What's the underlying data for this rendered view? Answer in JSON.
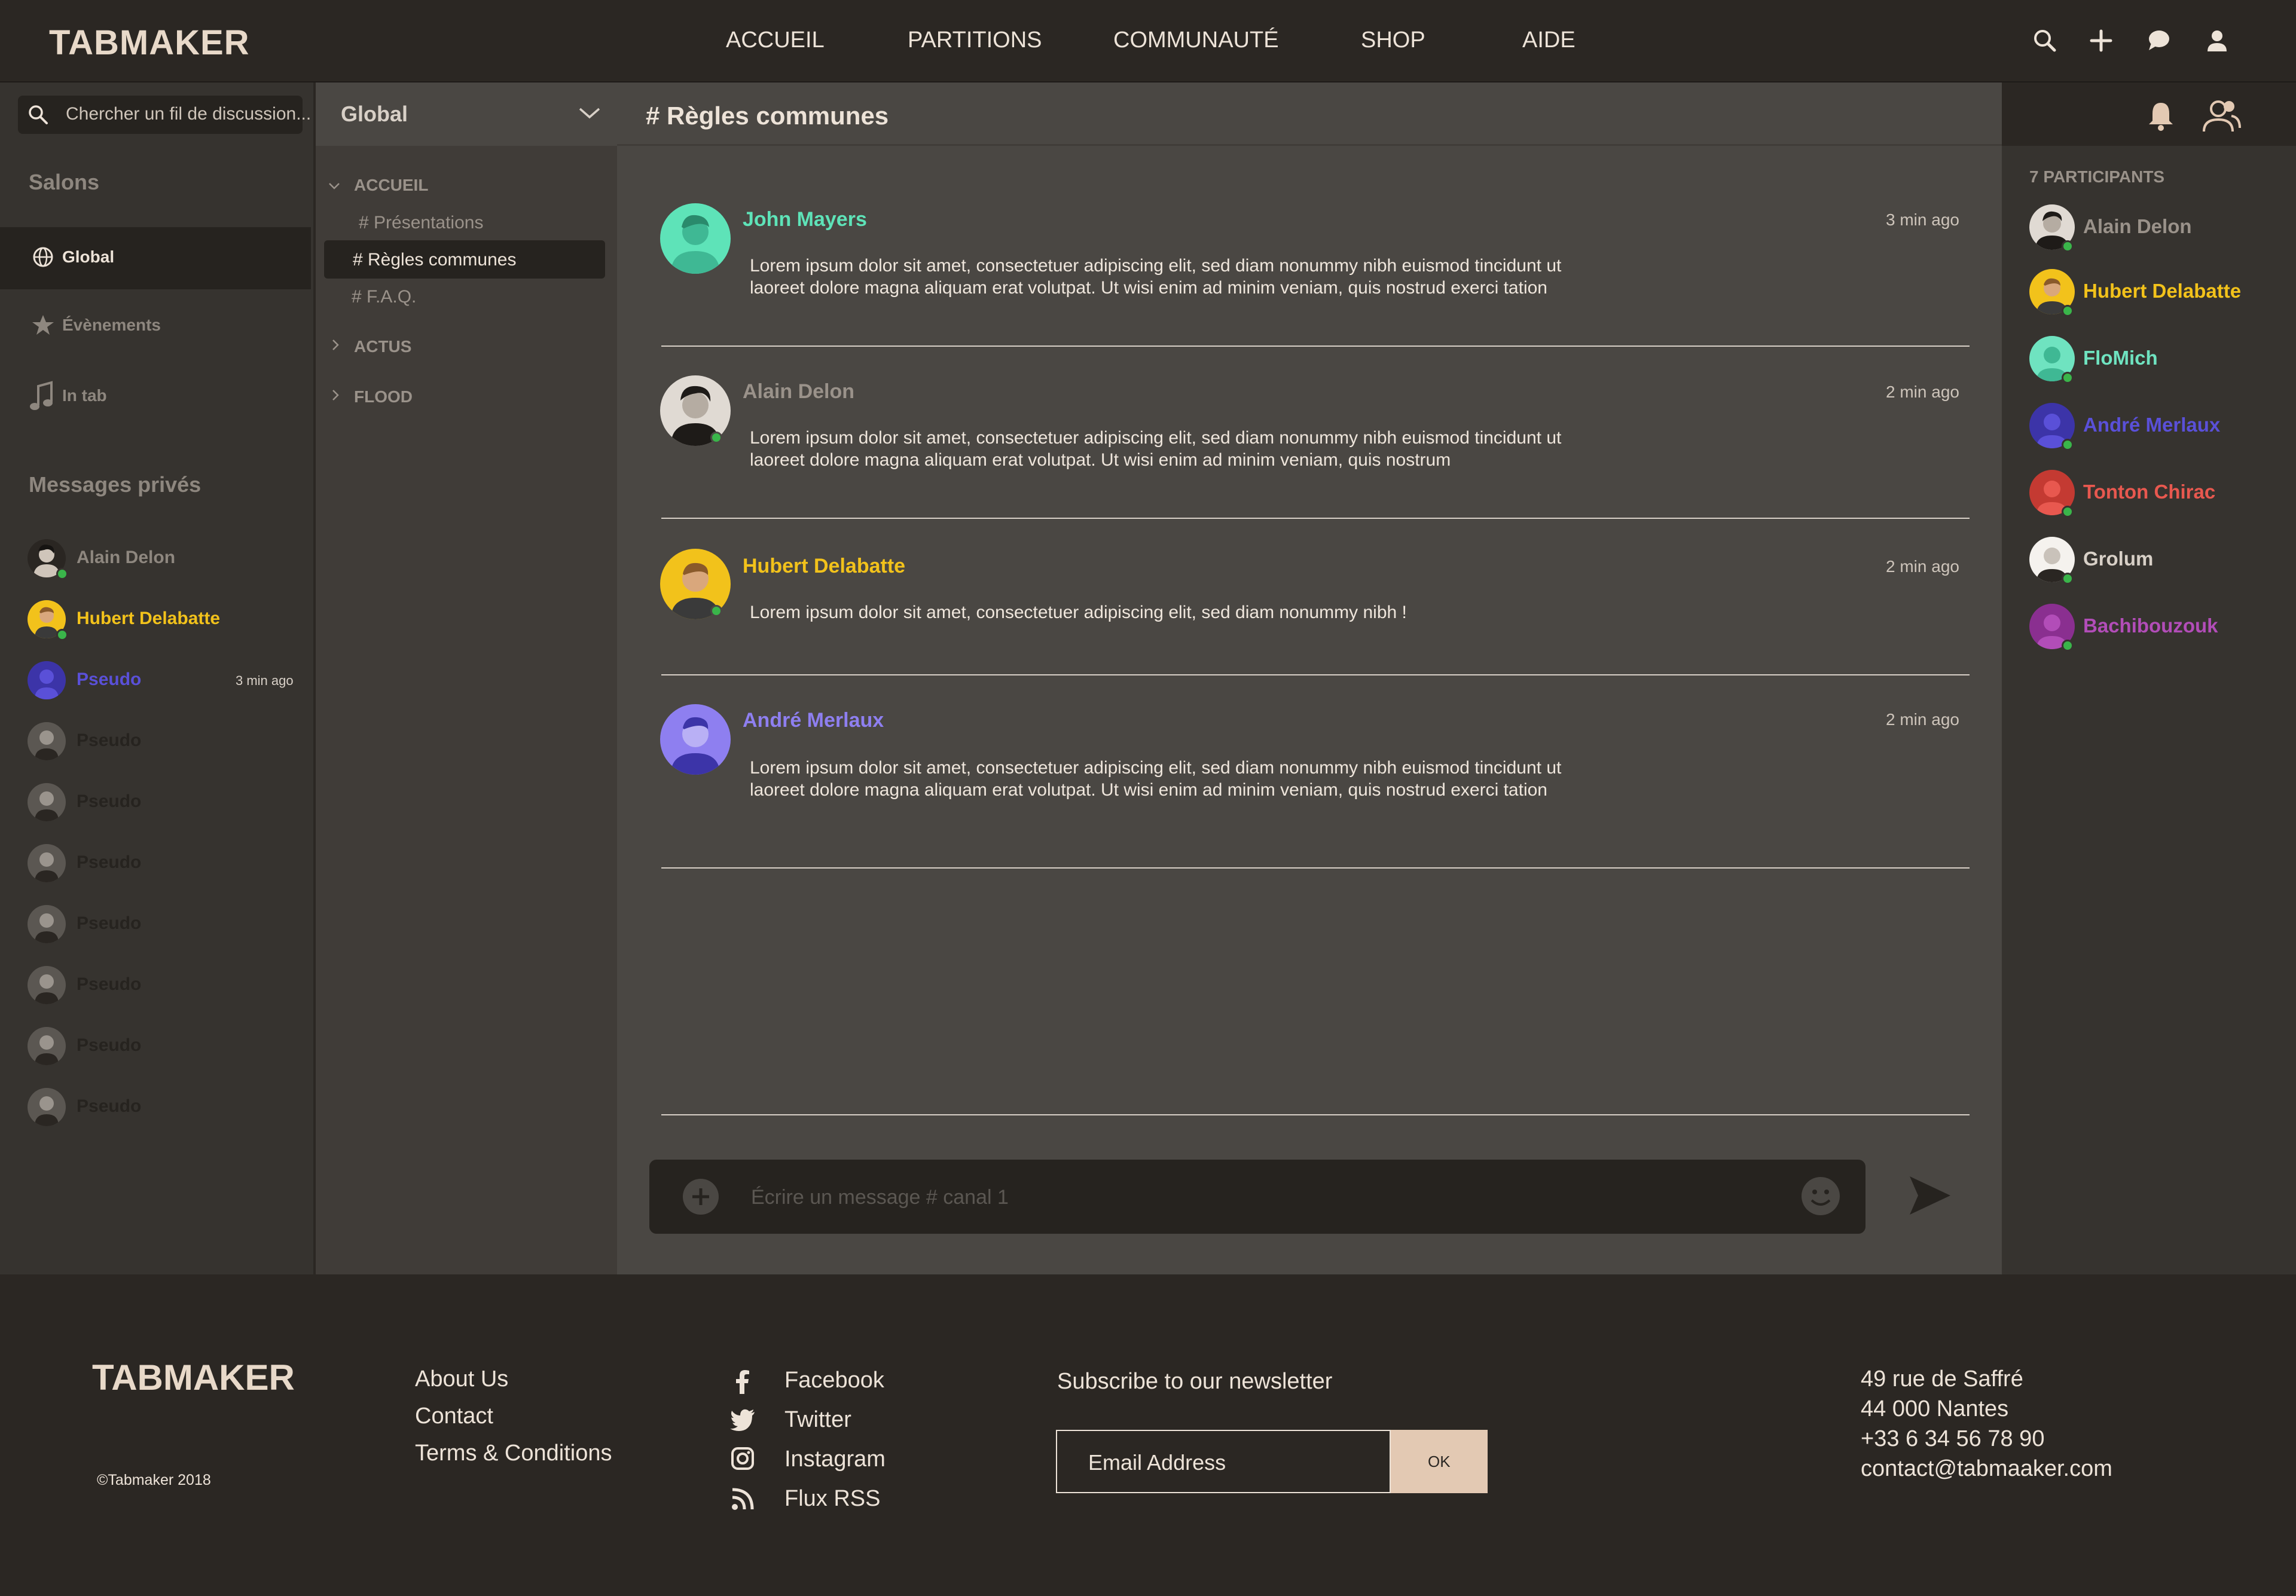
{
  "header": {
    "logo": "TABMAKER",
    "nav": [
      "ACCUEIL",
      "PARTITIONS",
      "COMMUNAUTÉ",
      "SHOP",
      "AIDE"
    ],
    "icons": [
      "search-icon",
      "plus-icon",
      "chat-bubble-icon",
      "user-icon"
    ]
  },
  "sidebar": {
    "search_placeholder": "Chercher un fil de discussion...",
    "salons_title": "Salons",
    "salons": [
      {
        "label": "Global",
        "icon": "globe-icon",
        "active": true
      },
      {
        "label": "Évènements",
        "icon": "star-icon",
        "active": false
      },
      {
        "label": "In tab",
        "icon": "music-note-icon",
        "active": false
      }
    ],
    "dm_title": "Messages privés",
    "dms": [
      {
        "name": "Alain Delon",
        "color": "#8e877f",
        "online": true,
        "time": ""
      },
      {
        "name": "Hubert Delabatte",
        "color": "#f2c21b",
        "online": true,
        "time": ""
      },
      {
        "name": "Pseudo",
        "color": "#5a50d8",
        "online": false,
        "time": "3 min ago"
      },
      {
        "name": "Pseudo",
        "color": "#26231f",
        "online": false,
        "time": ""
      },
      {
        "name": "Pseudo",
        "color": "#26231f",
        "online": false,
        "time": ""
      },
      {
        "name": "Pseudo",
        "color": "#26231f",
        "online": false,
        "time": ""
      },
      {
        "name": "Pseudo",
        "color": "#26231f",
        "online": false,
        "time": ""
      },
      {
        "name": "Pseudo",
        "color": "#26231f",
        "online": false,
        "time": ""
      },
      {
        "name": "Pseudo",
        "color": "#26231f",
        "online": false,
        "time": ""
      },
      {
        "name": "Pseudo",
        "color": "#26231f",
        "online": false,
        "time": ""
      }
    ]
  },
  "channels": {
    "server": "Global",
    "groups": [
      {
        "label": "ACCUEIL",
        "expanded": true,
        "items": [
          "# Présentations",
          "# Règles communes",
          "# F.A.Q."
        ]
      },
      {
        "label": "ACTUS",
        "expanded": false,
        "items": []
      },
      {
        "label": "FLOOD",
        "expanded": false,
        "items": []
      }
    ],
    "active_item": "# Règles communes"
  },
  "main": {
    "channel_title": "# Règles communes",
    "messages": [
      {
        "author": "John Mayers",
        "color": "#5ee3b8",
        "time": "3 min ago",
        "lines": [
          "Lorem ipsum dolor sit amet, consectetuer adipiscing elit, sed diam nonummy nibh euismod tincidunt ut",
          "laoreet dolore magna aliquam erat volutpat. Ut wisi enim ad minim veniam, quis nostrud exerci tation"
        ]
      },
      {
        "author": "Alain Delon",
        "color": "#9a928a",
        "time": "2 min ago",
        "lines": [
          "Lorem ipsum dolor sit amet, consectetuer adipiscing elit, sed diam nonummy nibh euismod tincidunt ut",
          "laoreet dolore magna aliquam erat volutpat. Ut wisi enim ad minim veniam, quis nostrum"
        ]
      },
      {
        "author": "Hubert Delabatte",
        "color": "#f2c21b",
        "time": "2 min ago",
        "lines": [
          "Lorem ipsum dolor sit amet, consectetuer adipiscing elit, sed diam nonummy nibh !"
        ]
      },
      {
        "author": "André Merlaux",
        "color": "#8e7ff0",
        "time": "2 min ago",
        "lines": [
          "Lorem ipsum dolor sit amet, consectetuer adipiscing elit, sed diam nonummy nibh euismod tincidunt ut",
          "laoreet dolore magna aliquam erat volutpat. Ut wisi enim ad minim veniam, quis nostrud exerci tation"
        ]
      }
    ],
    "composer_placeholder": "Écrire un message  # canal 1"
  },
  "participants": {
    "title": "7 PARTICIPANTS",
    "list": [
      {
        "name": "Alain Delon",
        "color": "#9a928a"
      },
      {
        "name": "Hubert Delabatte",
        "color": "#f2c21b"
      },
      {
        "name": "FloMich",
        "color": "#6fe3c0"
      },
      {
        "name": "André Merlaux",
        "color": "#5a50d8"
      },
      {
        "name": "Tonton Chirac",
        "color": "#e8584f"
      },
      {
        "name": "Grolum",
        "color": "#d8d0c7"
      },
      {
        "name": "Bachibouzouk",
        "color": "#b24db8"
      }
    ]
  },
  "footer": {
    "logo": "TABMAKER",
    "copyright": "©Tabmaker  2018",
    "links": [
      "About Us",
      "Contact",
      "Terms & Conditions"
    ],
    "social": [
      {
        "label": "Facebook",
        "icon": "facebook-icon"
      },
      {
        "label": "Twitter",
        "icon": "twitter-icon"
      },
      {
        "label": "Instagram",
        "icon": "instagram-icon"
      },
      {
        "label": "Flux RSS",
        "icon": "rss-icon"
      }
    ],
    "newsletter_title": "Subscribe to our newsletter",
    "email_placeholder": "Email Address",
    "ok_label": "OK",
    "address": [
      "49 rue de Saffré",
      "44 000 Nantes",
      "+33 6 34 56 78 90",
      "contact@tabmaaker.com"
    ]
  }
}
